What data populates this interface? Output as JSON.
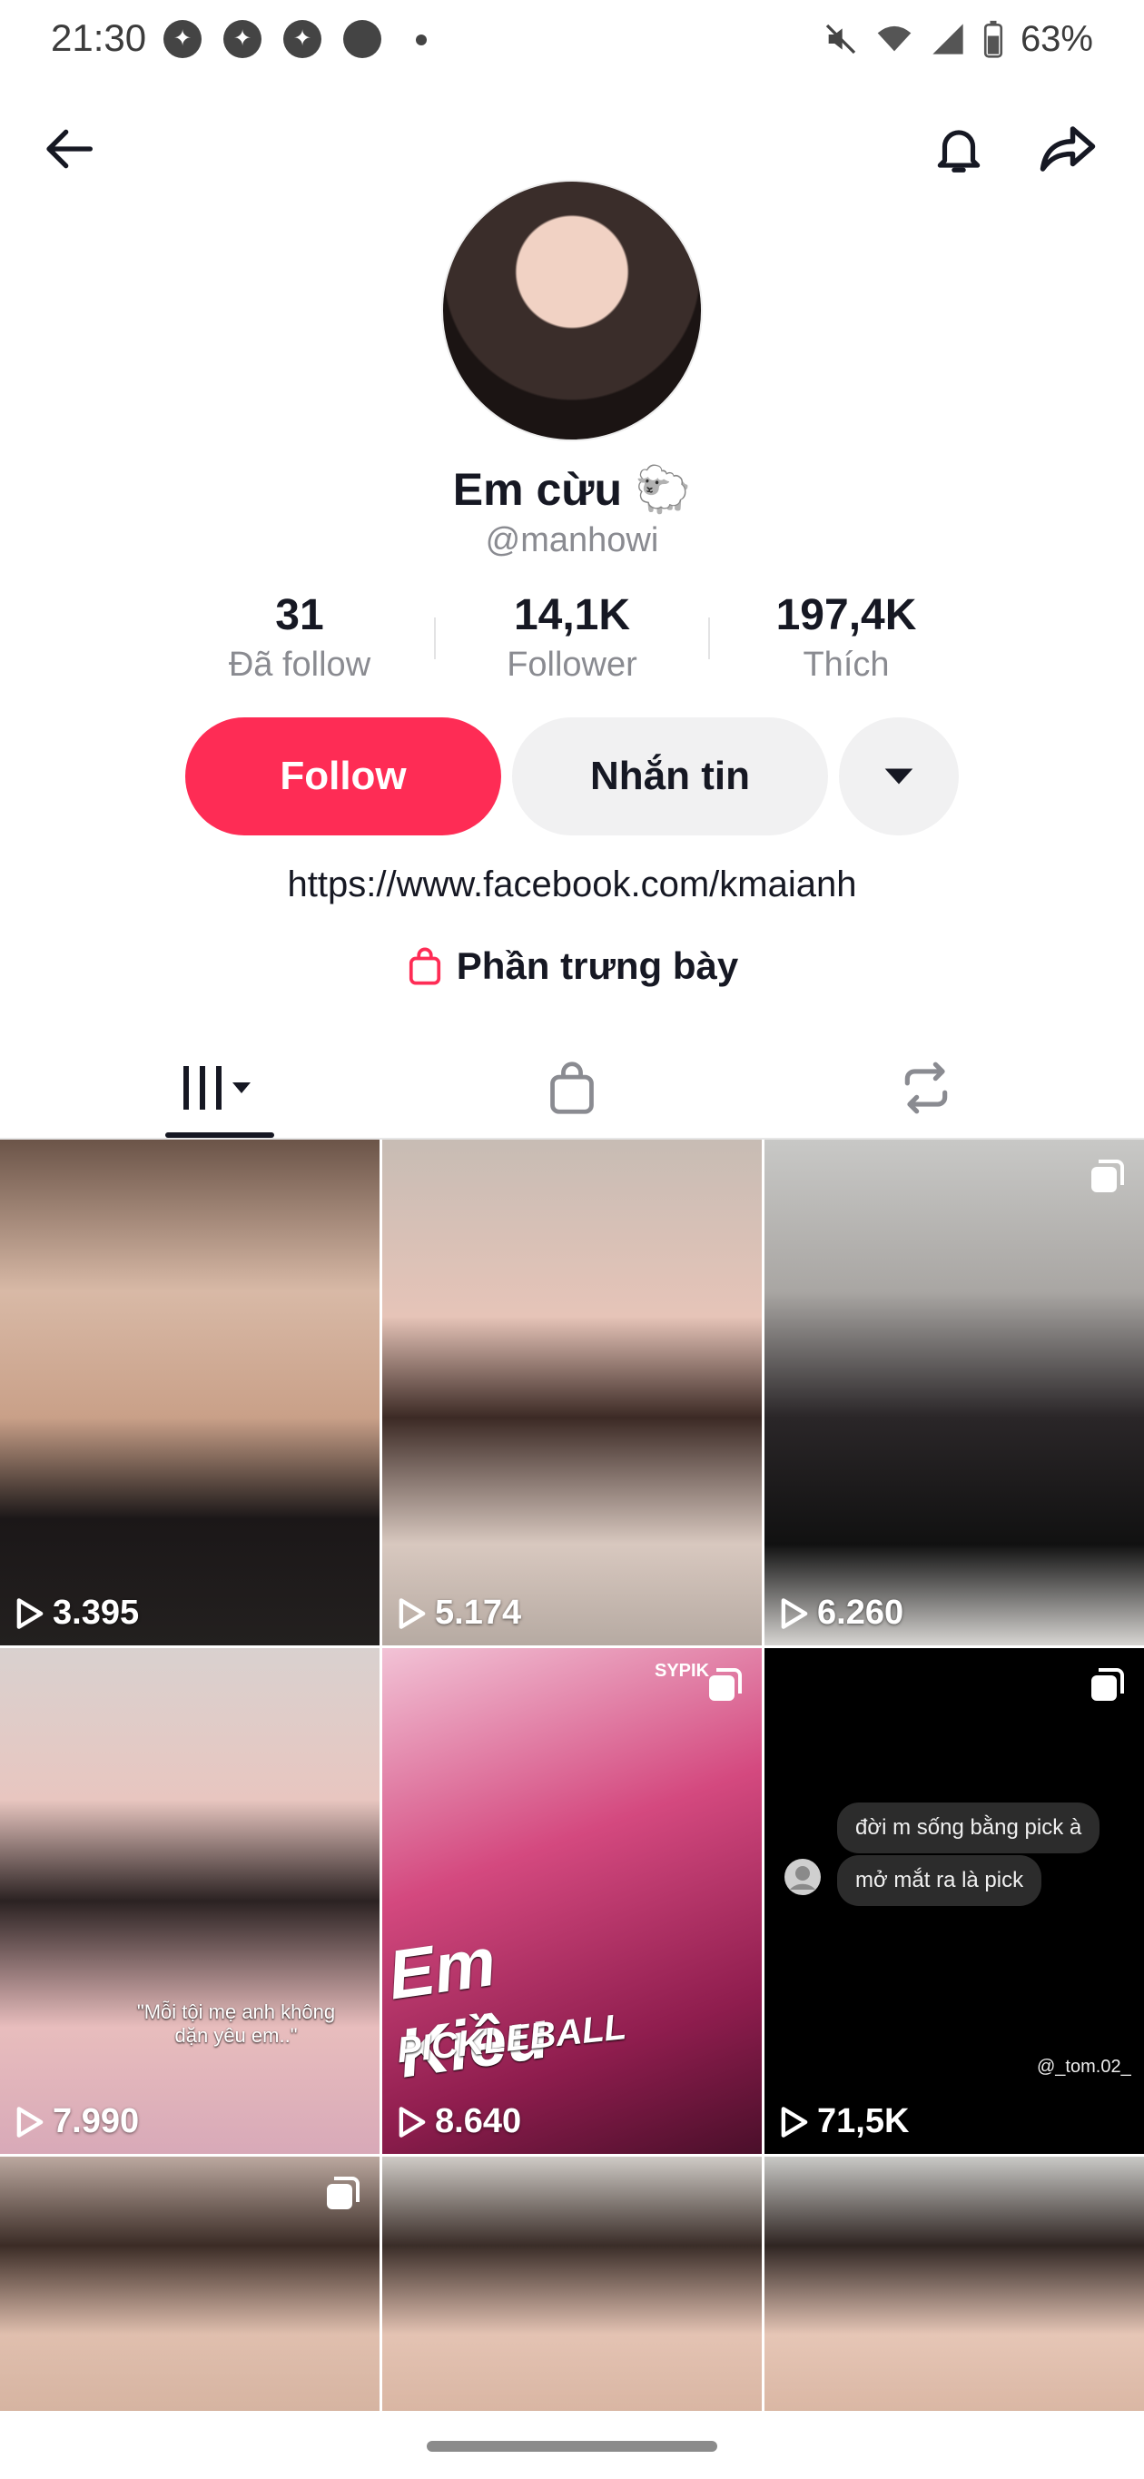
{
  "status_bar": {
    "time": "21:30",
    "battery": "63%",
    "icons": [
      "messenger-icon",
      "messenger-icon",
      "messenger-icon",
      "app-icon",
      "dot-icon",
      "mute-icon",
      "wifi-icon",
      "signal-icon",
      "battery-icon"
    ]
  },
  "profile": {
    "display_name": "Em cừu 🐑",
    "username": "@manhowi",
    "stats": [
      {
        "value": "31",
        "label": "Đã follow"
      },
      {
        "value": "14,1K",
        "label": "Follower"
      },
      {
        "value": "197,4K",
        "label": "Thích"
      }
    ],
    "follow_label": "Follow",
    "message_label": "Nhắn tin",
    "bio_link": "https://www.facebook.com/kmaianh",
    "showcase_label": "Phần trưng bày"
  },
  "tabs": [
    "videos-tab",
    "shop-tab",
    "reposts-tab"
  ],
  "videos": [
    {
      "views": "3.395",
      "multi": false
    },
    {
      "views": "5.174",
      "multi": false
    },
    {
      "views": "6.260",
      "multi": true
    },
    {
      "views": "7.990",
      "multi": false,
      "caption": "\"Mỗi tội mẹ anh không dặn yêu em..\""
    },
    {
      "views": "8.640",
      "multi": true,
      "overlay_title": "Em Kiều",
      "overlay_sub": "PICKLEBALL",
      "brand": "SYPIK"
    },
    {
      "views": "71,5K",
      "multi": true,
      "bubble1": "đời m sống bằng pick à",
      "bubble2": "mở mắt ra là pick",
      "tag": "@_tom.02_"
    },
    {
      "views": "",
      "multi": true
    },
    {
      "views": "",
      "multi": false
    },
    {
      "views": "",
      "multi": false
    }
  ],
  "colors": {
    "accent": "#fe2c55",
    "text": "#161823",
    "secondary_text": "#8a8b91"
  }
}
